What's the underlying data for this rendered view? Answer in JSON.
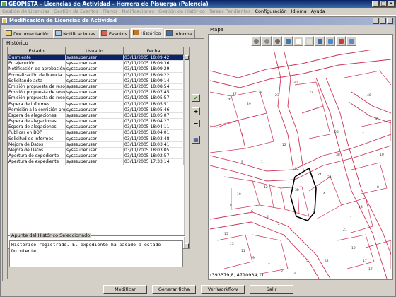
{
  "window": {
    "title": "GEOPISTA - Licencias de Actividad - Herrera de Pisuerga (Palencia)"
  },
  "menu": {
    "items": [
      {
        "label": "Gestión de Licencias",
        "enabled": false
      },
      {
        "label": "Gestión de Eventos",
        "enabled": false
      },
      {
        "label": "Planos",
        "enabled": false
      },
      {
        "label": "Notificaciones",
        "enabled": false
      },
      {
        "label": "Gestión de Histórico",
        "enabled": false
      },
      {
        "label": "Tareas Pendientes",
        "enabled": false
      },
      {
        "label": "Configuración",
        "enabled": true
      },
      {
        "label": "Idioma",
        "enabled": true
      },
      {
        "label": "Ayuda",
        "enabled": true
      }
    ]
  },
  "frame": {
    "title": "Modificación de Licencias de Actividad"
  },
  "tabs": [
    {
      "label": "Documentación",
      "icon": "documents-icon",
      "active": false
    },
    {
      "label": "Notificaciones",
      "icon": "notifications-icon",
      "active": false
    },
    {
      "label": "Eventos",
      "icon": "events-icon",
      "active": false
    },
    {
      "label": "Histórico",
      "icon": "history-icon",
      "active": true
    },
    {
      "label": "Informe",
      "icon": "report-icon",
      "active": false
    }
  ],
  "history": {
    "group_label": "Histórico",
    "columns": [
      "Estado",
      "Usuario",
      "Fecha"
    ],
    "rows": [
      {
        "estado": "Durmiente",
        "usuario": "sysssuperuser",
        "fecha": "03/11/2005 18:09:42",
        "selected": true
      },
      {
        "estado": "En ejecución",
        "usuario": "sysssuperuser",
        "fecha": "03/11/2005 18:09:36",
        "selected": false
      },
      {
        "estado": "Notificación de aprobación",
        "usuario": "sysssuperuser",
        "fecha": "03/11/2005 18:09:29",
        "selected": false
      },
      {
        "estado": "Formalización de licencia",
        "usuario": "sysssuperuser",
        "fecha": "03/11/2005 18:09:22",
        "selected": false
      },
      {
        "estado": "Solicitando acta",
        "usuario": "sysssuperuser",
        "fecha": "03/11/2005 18:09:14",
        "selected": false
      },
      {
        "estado": "Emisión propuesta de resolu",
        "usuario": "sysssuperuser",
        "fecha": "03/11/2005 18:08:54",
        "selected": false
      },
      {
        "estado": "Emisión propuesta de resolu",
        "usuario": "sysssuperuser",
        "fecha": "03/11/2005 18:07:45",
        "selected": false
      },
      {
        "estado": "Emisión propuesta de resolu",
        "usuario": "sysssuperuser",
        "fecha": "03/11/2005 18:05:57",
        "selected": false
      },
      {
        "estado": "Espera de informes",
        "usuario": "sysssuperuser",
        "fecha": "03/11/2005 18:05:51",
        "selected": false
      },
      {
        "estado": "Remisión a la comisión provi",
        "usuario": "sysssuperuser",
        "fecha": "03/11/2005 18:05:46",
        "selected": false
      },
      {
        "estado": "Espera de alegaciones",
        "usuario": "sysssuperuser",
        "fecha": "03/11/2005 18:05:07",
        "selected": false
      },
      {
        "estado": "Espera de alegaciones",
        "usuario": "sysssuperuser",
        "fecha": "03/11/2005 18:04:27",
        "selected": false
      },
      {
        "estado": "Espera de alegaciones",
        "usuario": "sysssuperuser",
        "fecha": "03/11/2005 18:04:11",
        "selected": false
      },
      {
        "estado": "Publicar en BOP",
        "usuario": "sysssuperuser",
        "fecha": "03/11/2005 18:04:01",
        "selected": false
      },
      {
        "estado": "Solicitud de informes",
        "usuario": "sysssuperuser",
        "fecha": "03/11/2005 18:03:48",
        "selected": false
      },
      {
        "estado": "Mejora de Datos",
        "usuario": "sysssuperuser",
        "fecha": "03/11/2005 18:03:41",
        "selected": false
      },
      {
        "estado": "Mejora de Datos",
        "usuario": "sysssuperuser",
        "fecha": "03/11/2005 18:03:05",
        "selected": false
      },
      {
        "estado": "Apertura de expediente",
        "usuario": "sysssuperuser",
        "fecha": "03/11/2005 18:02:57",
        "selected": false
      },
      {
        "estado": "Apertura de expediente",
        "usuario": "sysssuperuser",
        "fecha": "03/11/2005 17:33:14",
        "selected": false
      }
    ],
    "side_buttons": [
      {
        "name": "accept-check-button",
        "glyph": "✔",
        "color": "#2e8b00"
      },
      {
        "name": "add-button",
        "glyph": "+",
        "color": "#000000"
      },
      {
        "name": "remove-button",
        "glyph": "−",
        "color": "#000000"
      },
      {
        "name": "table-view-button",
        "glyph": "▦",
        "color": "#1f3f8f"
      }
    ]
  },
  "note": {
    "legend": "Apunte del Histórico Seleccionado",
    "text": "Historico registrado. El expediente ha pasado a estado\nDurmiente."
  },
  "map": {
    "label": "Mapa",
    "tools": [
      "zoom-in-icon",
      "select-icon",
      "layers-icon",
      "zoom-icon",
      "pan-icon",
      "measure-icon",
      "info-icon",
      "edit-icon",
      "print-icon",
      "grid-icon"
    ],
    "coords": "(393379,8, 4710934,1)",
    "numbers": [
      "30",
      "27",
      "26",
      "28",
      "29",
      "23",
      "22",
      "40",
      "36",
      "28",
      "38",
      "34",
      "32",
      "30",
      "18",
      "12",
      "10",
      "8",
      "6",
      "4",
      "2",
      "15",
      "13",
      "11",
      "9",
      "7",
      "5",
      "3",
      "1",
      "21",
      "19",
      "17",
      "24",
      "4",
      "2",
      "12",
      "10",
      "8",
      "12",
      "1",
      "9",
      "5",
      "42",
      "17"
    ],
    "parcel_color": "#cc3355",
    "street_color": "#cc3355"
  },
  "actions": {
    "modify": "Modificar",
    "generate": "Generar ficha",
    "workflow": "Ver Workflow",
    "exit": "Salir"
  }
}
